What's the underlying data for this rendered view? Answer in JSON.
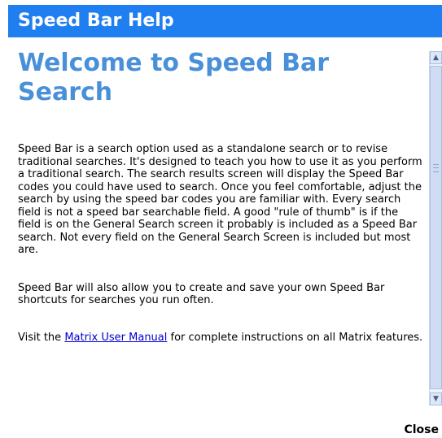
{
  "header": {
    "title": "Speed Bar Help"
  },
  "content": {
    "heading": "Welcome to Speed Bar Search",
    "paragraph1": "Speed Bar is a search option used as a standalone search or to revise traditional searches. It's designed to teach you how to use it as you perform a traditional search. The search results screen will display the Speed Bar codes you could have used to search. Once you feel comfortable, adjust the search by using the speed bar codes you are familiar with. Every search field is not a speed bar searchable field. A good \"rule of thumb\" is if the field is on the General Search screen it probably is included as a Speed Bar search. Not every field on the General Search Screen is included but most are.",
    "paragraph2": "Speed Bar will also allow you to create and save your own Speed Bar shortcuts for searches you run often.",
    "paragraph3": {
      "prefix": "Visit the ",
      "link_text": "Matrix User Manual",
      "suffix": " for complete instructions on all Matrix features."
    }
  },
  "scrollbar": {
    "up_icon": "chevron-up",
    "down_icon": "chevron-down"
  },
  "footer": {
    "close_label": "Close"
  },
  "colors": {
    "header_bg": "#1f7ef0",
    "heading": "#4a90d9",
    "link": "#0000cc"
  }
}
